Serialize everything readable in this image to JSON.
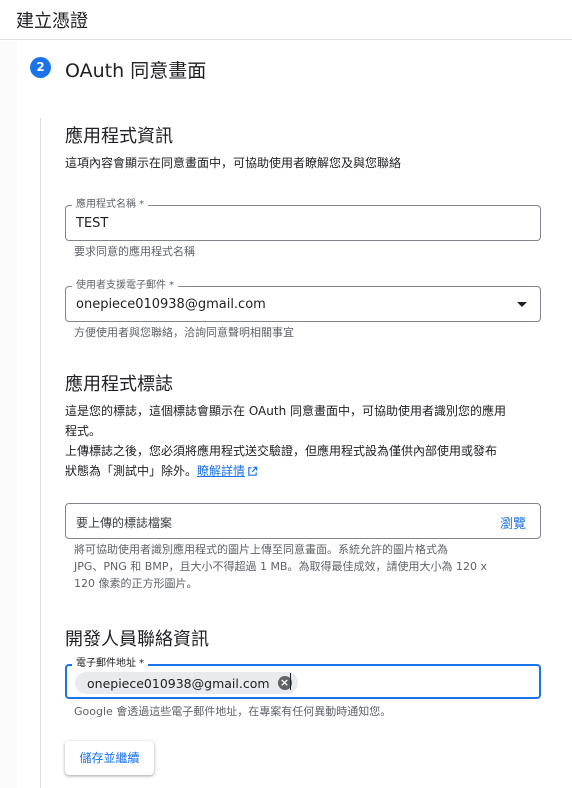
{
  "header": {
    "title": "建立憑證"
  },
  "step": {
    "number": "2",
    "title": "OAuth 同意畫面"
  },
  "app_info": {
    "title": "應用程式資訊",
    "description": "這項內容會顯示在同意畫面中，可協助使用者瞭解您及與您聯絡",
    "app_name": {
      "label": "應用程式名稱 *",
      "value": "TEST",
      "help": "要求同意的應用程式名稱"
    },
    "support_email": {
      "label": "使用者支援電子郵件 *",
      "value": "onepiece010938@gmail.com",
      "help": "方便使用者與您聯絡，洽詢同意聲明相關事宜"
    }
  },
  "app_logo": {
    "title": "應用程式標誌",
    "desc_line1": "這是您的標誌，這個標誌會顯示在 OAuth 同意畫面中，可協助使用者識別您的應用",
    "desc_line2": "程式。",
    "desc_line3": "上傳標誌之後，您必須將應用程式送交驗證，但應用程式設為僅供內部使用或發布",
    "desc_line4_prefix": "狀態為「測試中」除外。",
    "learn_more": "瞭解詳情",
    "upload_placeholder": "要上傳的標誌檔案",
    "browse": "瀏覽",
    "help_line1": "將可協助使用者識別應用程式的圖片上傳至同意畫面。系統允許的圖片格式為",
    "help_line2": "JPG、PNG 和 BMP，且大小不得超過 1 MB。為取得最佳成效，請使用大小為 120 x",
    "help_line3": "120 像素的正方形圖片。"
  },
  "developer": {
    "title": "開發人員聯絡資訊",
    "email_label": "電子郵件地址 *",
    "email_chip": "onepiece010938@gmail.com",
    "help": "Google 會透過這些電子郵件地址，在專案有任何異動時通知您。"
  },
  "actions": {
    "save": "儲存並繼續"
  },
  "colors": {
    "accent": "#1a73e8",
    "border": "#80868b"
  },
  "icons": [
    "dropdown-arrow-icon",
    "external-link-icon",
    "remove-chip-icon"
  ]
}
